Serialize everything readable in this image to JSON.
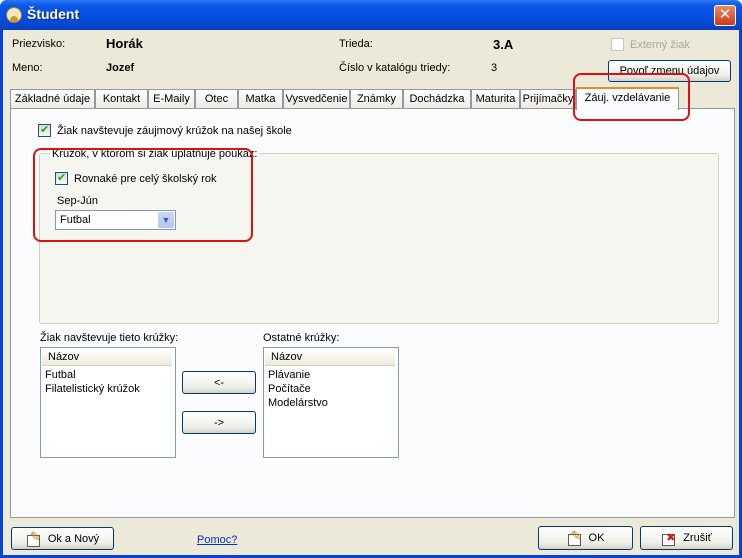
{
  "window": {
    "title": "Študent",
    "close_glyph": "✕"
  },
  "header": {
    "surname_label": "Priezvisko:",
    "surname_value": "Horák",
    "name_label": "Meno:",
    "name_value": "Jozef",
    "class_label": "Trieda:",
    "class_value": "3.A",
    "catalog_label": "Číslo v katalógu triedy:",
    "catalog_value": "3",
    "external_label": "Externý žiak",
    "external_checked": false,
    "change_history_button": "Povoľ zmenu údajov"
  },
  "tabs": [
    {
      "label": "Základné údaje"
    },
    {
      "label": "Kontakt"
    },
    {
      "label": "E-Maily"
    },
    {
      "label": "Otec"
    },
    {
      "label": "Matka"
    },
    {
      "label": "Vysvedčenie"
    },
    {
      "label": "Známky"
    },
    {
      "label": "Dochádzka"
    },
    {
      "label": "Maturita"
    },
    {
      "label": "Prijímačky"
    },
    {
      "label": "Záuj. vzdelávanie"
    }
  ],
  "active_tab": "Záuj. vzdelávanie",
  "panel": {
    "attends_checkbox_label": "Žiak navštevuje záujmový krúžok na našej škole",
    "attends_checked": true,
    "group_title": "Krúžok, v ktorom si žiak uplatňuje poukaz:",
    "same_year_label": "Rovnaké pre celý školský rok",
    "same_year_checked": true,
    "period_label": "Sep-Jún",
    "period_select_value": "Futbal"
  },
  "lists": {
    "attended_title": "Žiak navštevuje tieto krúžky:",
    "attended_header": "Názov",
    "attended_items": [
      "Futbal",
      "Filatelistický krúžok"
    ],
    "other_title": "Ostatné krúžky:",
    "other_header": "Názov",
    "other_items": [
      "Plávanie",
      "Počítače",
      "Modelárstvo"
    ],
    "move_left_button": "<-",
    "move_right_button": "->"
  },
  "footer": {
    "ok_new_button": "Ok a Nový",
    "help_link": "Pomoc?",
    "ok_button": "OK",
    "cancel_button": "Zrušiť"
  },
  "colors": {
    "titlebar": "#0a58e6",
    "dialog_bg": "#ece9d8",
    "highlight_outline": "#e01010",
    "active_tab_accent": "#e68b2c"
  }
}
